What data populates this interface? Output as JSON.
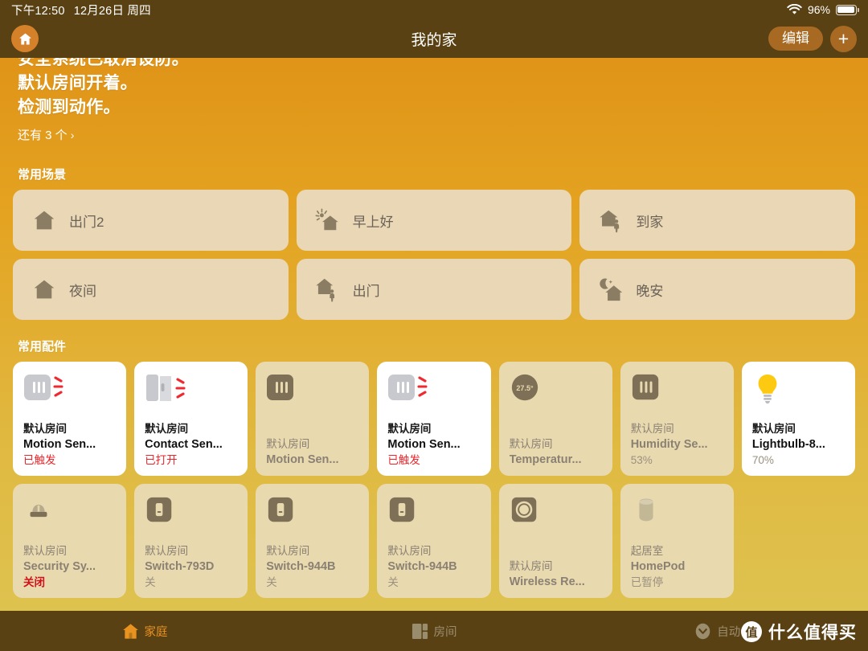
{
  "status_bar": {
    "time": "下午12:50",
    "date": "12月26日 周四",
    "wifi_icon": "wifi-icon",
    "battery_percent": "96%",
    "battery_icon": "battery-icon"
  },
  "nav": {
    "home_icon": "house-icon",
    "title": "我的家",
    "edit_label": "编辑",
    "add_icon": "plus-icon"
  },
  "home_status": {
    "lines": [
      "安全系统已取消设防。",
      "默认房间开着。",
      "检测到动作。"
    ],
    "more_label": "还有 3 个",
    "more_chevron": "›"
  },
  "scenes": {
    "section_title": "常用场景",
    "items": [
      {
        "label": "出门2",
        "icon": "house-icon"
      },
      {
        "label": "早上好",
        "icon": "sun-house-icon"
      },
      {
        "label": "到家",
        "icon": "house-person-arrive-icon"
      },
      {
        "label": "夜间",
        "icon": "house-icon"
      },
      {
        "label": "出门",
        "icon": "house-person-leave-icon"
      },
      {
        "label": "晚安",
        "icon": "moon-house-icon"
      }
    ]
  },
  "accessories": {
    "section_title": "常用配件",
    "items": [
      {
        "room": "默认房间",
        "name": "Motion Sen...",
        "state": "已触发",
        "icon": "motion-sensor-icon",
        "active": true,
        "state_style": "alert"
      },
      {
        "room": "默认房间",
        "name": "Contact Sen...",
        "state": "已打开",
        "icon": "contact-sensor-icon",
        "active": true,
        "state_style": "alert"
      },
      {
        "room": "默认房间",
        "name": "Motion Sen...",
        "state": "",
        "icon": "motion-sensor-icon",
        "active": false,
        "state_style": ""
      },
      {
        "room": "默认房间",
        "name": "Motion Sen...",
        "state": "已触发",
        "icon": "motion-sensor-icon",
        "active": true,
        "state_style": "alert"
      },
      {
        "room": "默认房间",
        "name": "Temperatur...",
        "state": "",
        "icon": "temperature-icon",
        "active": false,
        "state_style": "",
        "badge": "27.5°"
      },
      {
        "room": "默认房间",
        "name": "Humidity Se...",
        "state": "53%",
        "icon": "humidity-sensor-icon",
        "active": false,
        "state_style": ""
      },
      {
        "room": "默认房间",
        "name": "Lightbulb-8...",
        "state": "70%",
        "icon": "lightbulb-icon",
        "active": true,
        "state_style": ""
      },
      {
        "room": "默认房间",
        "name": "Security Sy...",
        "state": "关闭",
        "icon": "security-system-icon",
        "active": false,
        "state_style": "alert-dim"
      },
      {
        "room": "默认房间",
        "name": "Switch-793D",
        "state": "关",
        "icon": "switch-icon",
        "active": false,
        "state_style": ""
      },
      {
        "room": "默认房间",
        "name": "Switch-944B",
        "state": "关",
        "icon": "switch-icon",
        "active": false,
        "state_style": ""
      },
      {
        "room": "默认房间",
        "name": "Switch-944B",
        "state": "关",
        "icon": "switch-icon",
        "active": false,
        "state_style": ""
      },
      {
        "room": "默认房间",
        "name": "Wireless Re...",
        "state": "",
        "icon": "wireless-remote-icon",
        "active": false,
        "state_style": ""
      },
      {
        "room": "起居室",
        "name": "HomePod",
        "state": "已暂停",
        "icon": "homepod-icon",
        "active": false,
        "state_style": ""
      }
    ]
  },
  "tabs": [
    {
      "label": "家庭",
      "icon": "house-icon",
      "active": true
    },
    {
      "label": "房间",
      "icon": "rooms-icon",
      "active": false
    },
    {
      "label": "自动化",
      "icon": "automation-icon",
      "active": false
    }
  ],
  "watermark": {
    "badge": "值",
    "text": "什么值得买"
  },
  "colors": {
    "accent_orange": "#e8921f",
    "chrome_brown": "#5a4114",
    "gradient_top": "#e09418",
    "gradient_bottom": "#dec24f",
    "alert_red": "#e8262b",
    "card_beige": "#e9d9af",
    "scene_card": "#e9d7b6"
  }
}
